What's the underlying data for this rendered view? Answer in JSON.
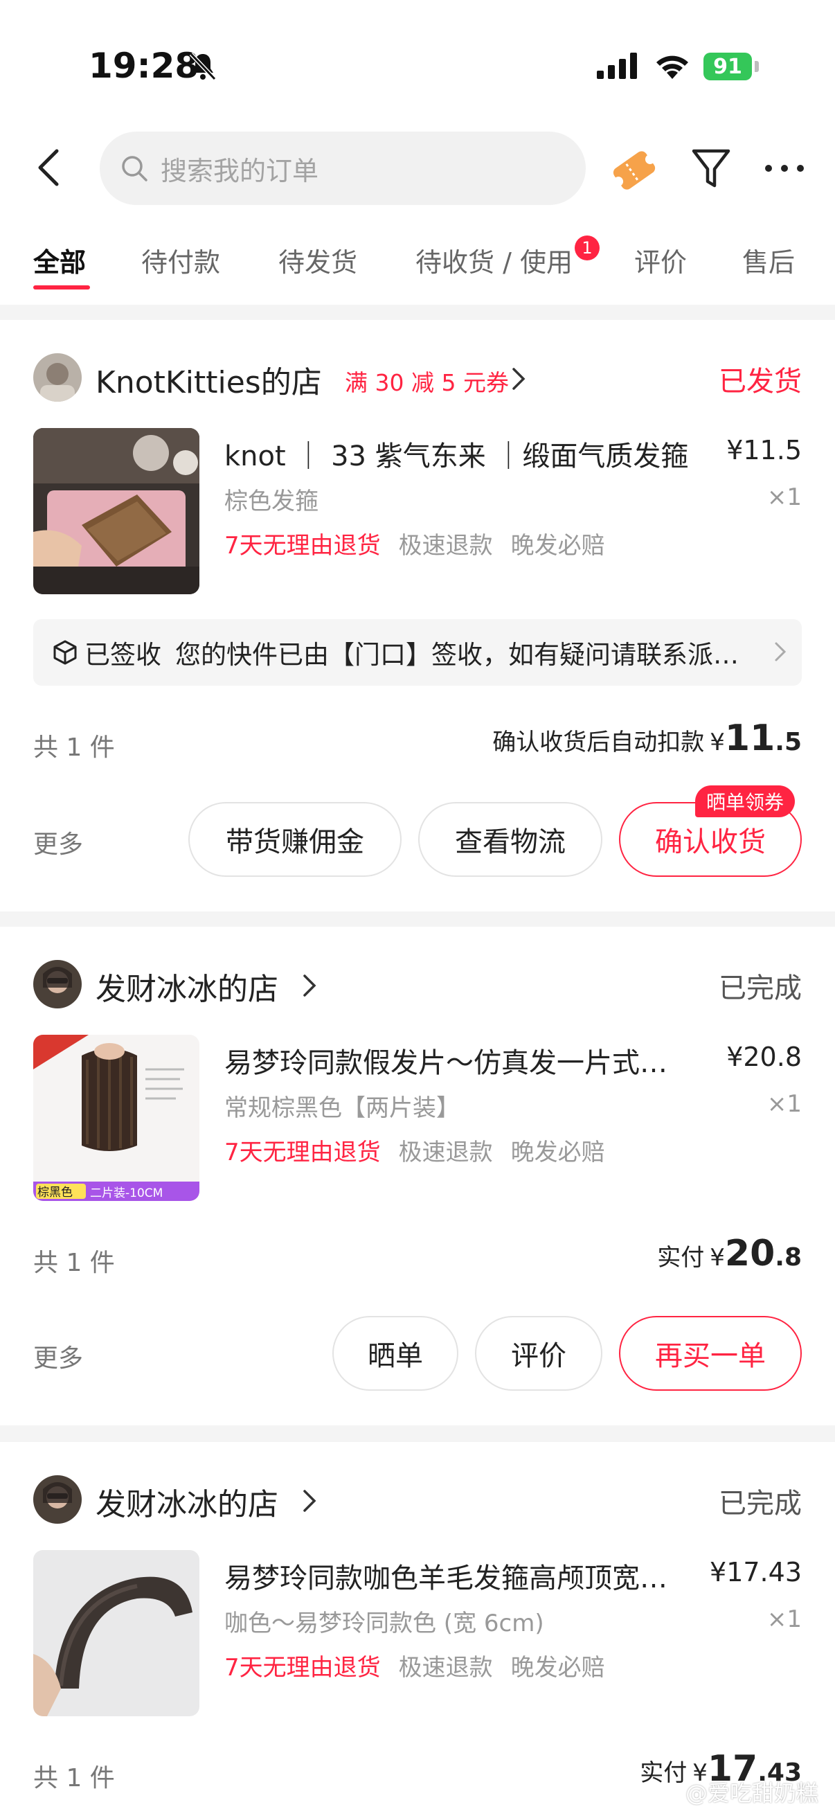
{
  "status_bar": {
    "time": "19:28",
    "battery": "91"
  },
  "search": {
    "placeholder": "搜索我的订单"
  },
  "tabs": [
    {
      "label": "全部",
      "active": true
    },
    {
      "label": "待付款"
    },
    {
      "label": "待发货"
    },
    {
      "label": "待收货 / 使用",
      "badge": "1"
    },
    {
      "label": "评价"
    },
    {
      "label": "售后"
    }
  ],
  "orders": [
    {
      "shop": "KnotKitties的店",
      "promo": "满 30 减 5 元券",
      "status": "已发货",
      "title": "knot ｜ 33 紫气东来 ｜缎面气质发箍",
      "price": "¥11.5",
      "spec": "棕色发箍",
      "qty": "×1",
      "tags": [
        "7天无理由退货",
        "极速退款",
        "晚发必赔"
      ],
      "logistics_label": "已签收",
      "logistics_text": "您的快件已由【门口】签收，如有疑问请联系派送员",
      "count": "共 1 件",
      "pay_label": "确认收货后自动扣款",
      "pay_currency": "¥",
      "pay_int": "11",
      "pay_dec": ".5",
      "more": "更多",
      "buttons": [
        "带货赚佣金",
        "查看物流",
        "确认收货"
      ],
      "corner_badge": "晒单领券"
    },
    {
      "shop": "发财冰冰的店",
      "status": "已完成",
      "title": "易梦玲同款假发片～仿真发一片式无痕增发量",
      "price": "¥20.8",
      "spec": "常规棕黑色【两片装】",
      "qty": "×1",
      "tags": [
        "7天无理由退货",
        "极速退款",
        "晚发必赔"
      ],
      "thumb_label_1": "棕黑色",
      "thumb_label_2": "二片装-10CM",
      "count": "共 1 件",
      "pay_label": "实付",
      "pay_currency": "¥",
      "pay_int": "20",
      "pay_dec": ".8",
      "more": "更多",
      "buttons": [
        "晒单",
        "评价",
        "再买一单"
      ]
    },
    {
      "shop": "发财冰冰的店",
      "status": "已完成",
      "title": "易梦玲同款咖色羊毛发箍高颅顶宽边发箍",
      "price": "¥17.43",
      "spec": "咖色～易梦玲同款色 (宽 6cm)",
      "qty": "×1",
      "tags": [
        "7天无理由退货",
        "极速退款",
        "晚发必赔"
      ],
      "count": "共 1 件",
      "pay_label": "实付",
      "pay_currency": "¥",
      "pay_int": "17",
      "pay_dec": ".43"
    }
  ],
  "watermark": "@爱吃甜奶糕"
}
